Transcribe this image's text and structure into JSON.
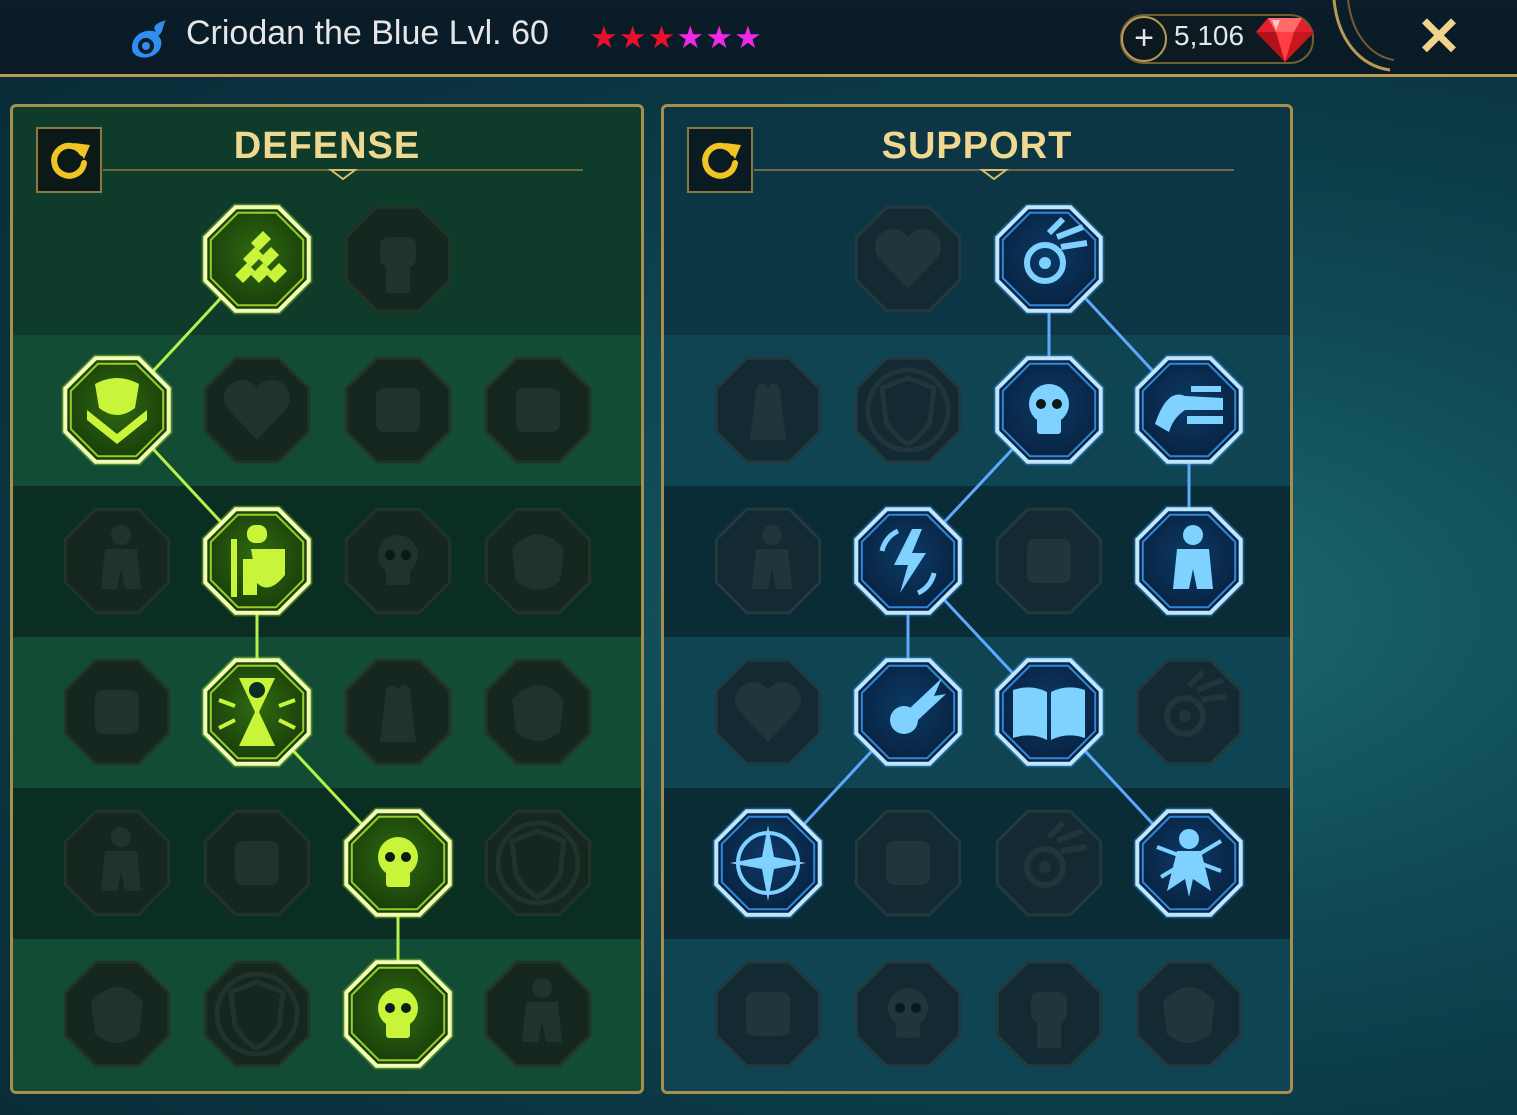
{
  "header": {
    "hero_name": "Criodan the Blue Lvl. 60",
    "stars": [
      {
        "color": "red"
      },
      {
        "color": "red"
      },
      {
        "color": "red"
      },
      {
        "color": "pink"
      },
      {
        "color": "pink"
      },
      {
        "color": "pink"
      }
    ],
    "add_currency_label": "+",
    "gem_amount": "5,106",
    "close_label": "✕"
  },
  "colors": {
    "defense_active": "#a6e41a",
    "support_active": "#36a8e6",
    "gold_accent": "#b89a52",
    "star_red": "#e8102a",
    "star_pink": "#ee28e6"
  },
  "panels": [
    {
      "id": "defense",
      "title": "DEFENSE",
      "theme": "green",
      "nodes": [
        {
          "row": 0,
          "col": 1,
          "icon": "shards-icon",
          "active": true
        },
        {
          "row": 0,
          "col": 2,
          "icon": "fist-icon",
          "active": false
        },
        {
          "row": 1,
          "col": 0,
          "icon": "chevron-shield-icon",
          "active": true
        },
        {
          "row": 1,
          "col": 1,
          "icon": "heart-organ-icon",
          "active": false
        },
        {
          "row": 1,
          "col": 2,
          "icon": "stone-golem-icon",
          "active": false
        },
        {
          "row": 1,
          "col": 3,
          "icon": "crossed-blades-icon",
          "active": false
        },
        {
          "row": 2,
          "col": 0,
          "icon": "fighter-pose-icon",
          "active": false
        },
        {
          "row": 2,
          "col": 1,
          "icon": "knight-shield-icon",
          "active": true
        },
        {
          "row": 2,
          "col": 2,
          "icon": "skull-heart-icon",
          "active": false
        },
        {
          "row": 2,
          "col": 3,
          "icon": "hooded-face-icon",
          "active": false
        },
        {
          "row": 3,
          "col": 0,
          "icon": "crowd-icon",
          "active": false
        },
        {
          "row": 3,
          "col": 1,
          "icon": "skull-hourglass-icon",
          "active": true
        },
        {
          "row": 3,
          "col": 2,
          "icon": "open-hand-icon",
          "active": false
        },
        {
          "row": 3,
          "col": 3,
          "icon": "bull-head-icon",
          "active": false
        },
        {
          "row": 4,
          "col": 0,
          "icon": "running-man-icon",
          "active": false
        },
        {
          "row": 4,
          "col": 1,
          "icon": "drops-icon",
          "active": false
        },
        {
          "row": 4,
          "col": 2,
          "icon": "spiked-skull-icon",
          "active": true
        },
        {
          "row": 4,
          "col": 3,
          "icon": "sword-circle-icon",
          "active": false
        },
        {
          "row": 5,
          "col": 0,
          "icon": "demon-bust-icon",
          "active": false
        },
        {
          "row": 5,
          "col": 1,
          "icon": "winged-shield-icon",
          "active": false
        },
        {
          "row": 5,
          "col": 2,
          "icon": "screaming-skull-icon",
          "active": true
        },
        {
          "row": 5,
          "col": 3,
          "icon": "strongman-icon",
          "active": false
        }
      ],
      "links": [
        [
          0,
          1,
          1,
          0
        ],
        [
          1,
          0,
          2,
          1
        ],
        [
          2,
          1,
          3,
          1
        ],
        [
          3,
          1,
          4,
          2
        ],
        [
          4,
          2,
          5,
          2
        ]
      ]
    },
    {
      "id": "support",
      "title": "SUPPORT",
      "theme": "blue",
      "nodes": [
        {
          "row": 0,
          "col": 1,
          "icon": "heart-plus-icon",
          "active": false
        },
        {
          "row": 0,
          "col": 2,
          "icon": "radiant-eye-icon",
          "active": true
        },
        {
          "row": 1,
          "col": 0,
          "icon": "praying-hands-icon",
          "active": false
        },
        {
          "row": 1,
          "col": 1,
          "icon": "ward-shield-icon",
          "active": false
        },
        {
          "row": 1,
          "col": 2,
          "icon": "burning-skull-icon",
          "active": true
        },
        {
          "row": 1,
          "col": 3,
          "icon": "slashing-arm-icon",
          "active": true
        },
        {
          "row": 2,
          "col": 0,
          "icon": "caster-figure-icon",
          "active": false
        },
        {
          "row": 2,
          "col": 1,
          "icon": "lightning-cycle-icon",
          "active": true
        },
        {
          "row": 2,
          "col": 2,
          "icon": "cracked-ground-icon",
          "active": false
        },
        {
          "row": 2,
          "col": 3,
          "icon": "shadow-figure-icon",
          "active": true
        },
        {
          "row": 3,
          "col": 0,
          "icon": "chained-heart-icon",
          "active": false
        },
        {
          "row": 3,
          "col": 1,
          "icon": "comet-icon",
          "active": true
        },
        {
          "row": 3,
          "col": 2,
          "icon": "open-book-icon",
          "active": true
        },
        {
          "row": 3,
          "col": 3,
          "icon": "glaring-eyes-icon",
          "active": false
        },
        {
          "row": 4,
          "col": 0,
          "icon": "compass-star-icon",
          "active": true
        },
        {
          "row": 4,
          "col": 1,
          "icon": "swift-boot-icon",
          "active": false
        },
        {
          "row": 4,
          "col": 2,
          "icon": "moon-eye-icon",
          "active": false
        },
        {
          "row": 4,
          "col": 3,
          "icon": "voodoo-doll-icon",
          "active": true
        },
        {
          "row": 5,
          "col": 0,
          "icon": "potion-flask-icon",
          "active": false
        },
        {
          "row": 5,
          "col": 1,
          "icon": "horned-skull-icon",
          "active": false
        },
        {
          "row": 5,
          "col": 2,
          "icon": "gripping-fist-icon",
          "active": false
        },
        {
          "row": 5,
          "col": 3,
          "icon": "eagle-head-icon",
          "active": false
        }
      ],
      "links": [
        [
          0,
          2,
          1,
          2
        ],
        [
          0,
          2,
          1,
          3
        ],
        [
          1,
          2,
          2,
          1
        ],
        [
          1,
          3,
          2,
          3
        ],
        [
          2,
          1,
          3,
          1
        ],
        [
          2,
          1,
          3,
          2
        ],
        [
          3,
          1,
          4,
          0
        ],
        [
          3,
          2,
          4,
          3
        ]
      ]
    }
  ]
}
